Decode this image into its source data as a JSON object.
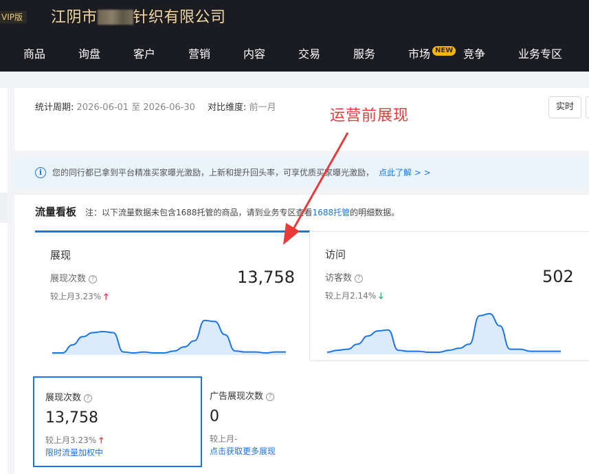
{
  "header": {
    "vip_badge": "VIP版",
    "company_prefix": "江阴市",
    "company_suffix": "针织有限公司",
    "nav": [
      {
        "label": "商品"
      },
      {
        "label": "询盘"
      },
      {
        "label": "客户"
      },
      {
        "label": "营销"
      },
      {
        "label": "内容"
      },
      {
        "label": "交易"
      },
      {
        "label": "服务"
      },
      {
        "label": "市场",
        "badge": "NEW"
      },
      {
        "label": "竞争"
      },
      {
        "label": "业务专区"
      }
    ]
  },
  "filters": {
    "period_label": "统计周期:",
    "period_value": "2026-06-01 至 2026-06-30",
    "compare_label": "对比维度:",
    "compare_value": "前一月",
    "realtime_button": "实时"
  },
  "notice": {
    "text": "您的同行都已拿到平台精准买家曝光激励，上新和提升回头率，可享优质买家曝光激励，",
    "link": "点此了解 > >"
  },
  "board": {
    "title": "流量看板",
    "note_prefix": "注：以下流量数据未包含1688托管的商品，请到业务专区查看",
    "note_link": "1688托管",
    "note_suffix": "的明细数据。"
  },
  "cards": [
    {
      "title": "展现",
      "label": "展现次数",
      "value": "13,758",
      "compare": "较上月3.23%",
      "trend": "up",
      "sparkline": [
        2,
        2,
        10,
        18,
        22,
        23,
        22,
        3,
        2,
        3,
        2,
        2,
        4,
        8,
        14,
        34,
        33,
        20,
        4,
        3,
        3,
        2,
        3,
        3
      ]
    },
    {
      "title": "访问",
      "label": "访客数",
      "value": "502",
      "compare": "较上月2.14%",
      "trend": "down",
      "sparkline": [
        2,
        4,
        5,
        10,
        18,
        23,
        24,
        4,
        3,
        3,
        2,
        2,
        4,
        6,
        10,
        38,
        40,
        28,
        5,
        5,
        3,
        3,
        3,
        3
      ]
    }
  ],
  "sub_cards": [
    {
      "label": "展现次数",
      "value": "13,758",
      "compare": "较上月3.23%",
      "trend": "up",
      "link": "限时流量加权中"
    },
    {
      "label": "广告展现次数",
      "value": "0",
      "compare": "较上月-",
      "link": "点击获取更多展现"
    }
  ],
  "annotation": {
    "text": "运营前展现",
    "color": "#e83a3a"
  },
  "colors": {
    "accent": "#1a74e8",
    "up": "#e02e3a",
    "down": "#1aa66b",
    "header_bg": "#1b1b22"
  }
}
